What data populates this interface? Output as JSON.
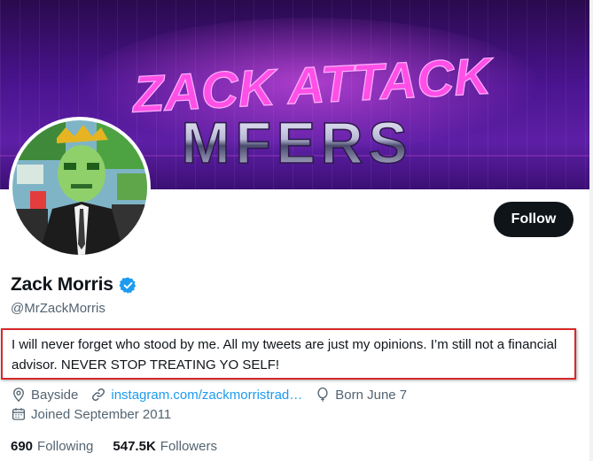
{
  "banner": {
    "line1": "ZACK ATTACK",
    "line2": "MFERS"
  },
  "profile": {
    "display_name": "Zack Morris",
    "handle": "@MrZackMorris",
    "bio": "I will never forget who stood by me. All my tweets are just my opinions. I’m still not a financial advisor. NEVER STOP TREATING YO SELF!",
    "verified": true
  },
  "actions": {
    "follow_label": "Follow"
  },
  "meta": {
    "location": "Bayside",
    "url": "instagram.com/zackmorristrad…",
    "birthday": "Born June 7",
    "joined": "Joined September 2011"
  },
  "stats": {
    "following_count": "690",
    "following_label": "Following",
    "followers_count": "547.5K",
    "followers_label": "Followers"
  },
  "colors": {
    "accent": "#1d9bf0",
    "text": "#0f1419",
    "secondary_text": "#536471",
    "highlight_border": "#d9282a",
    "banner_pink": "#e040e0"
  },
  "icons": {
    "verified": "verified-badge-icon",
    "location": "location-pin-icon",
    "link": "link-icon",
    "birthday": "balloon-icon",
    "joined": "calendar-icon"
  }
}
